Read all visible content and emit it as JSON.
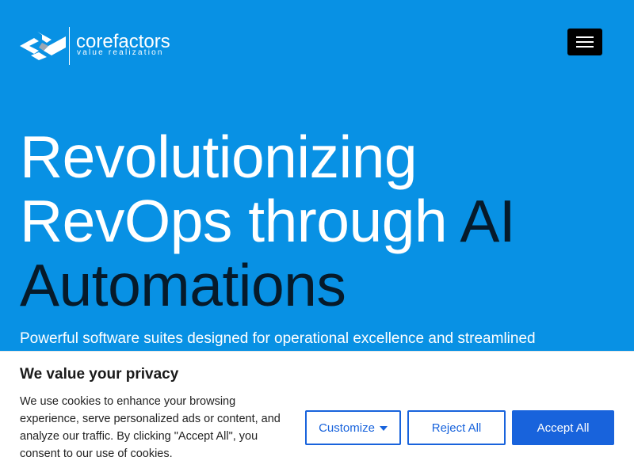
{
  "brand": {
    "name": "corefactors",
    "tagline": "value realization"
  },
  "nav": {
    "menu_icon": "hamburger-menu-icon"
  },
  "hero": {
    "headline_line1": "Revolutionizing",
    "headline_line2a": "RevOps through ",
    "headline_line2b": "AI",
    "headline_line3": "Automations",
    "subtitle": "Powerful software suites designed for operational excellence and streamlined"
  },
  "consent": {
    "title": "We value your privacy",
    "text": "We use cookies to enhance your browsing experience, serve personalized ads or content, and analyze our traffic. By clicking \"Accept All\", you consent to our use of cookies.",
    "customize_label": "Customize",
    "reject_label": "Reject All",
    "accept_label": "Accept All"
  },
  "colors": {
    "hero_bg": "#0891e4",
    "accent_dark": "#061a2a",
    "button_blue": "#1863dc"
  }
}
